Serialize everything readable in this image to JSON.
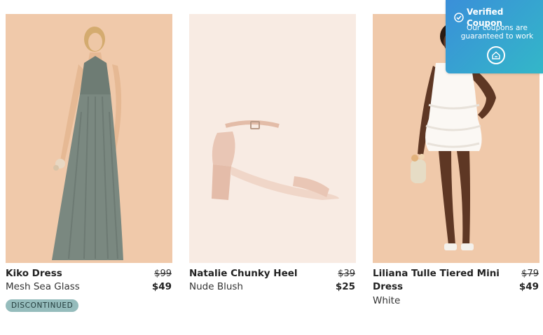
{
  "products": [
    {
      "name": "Kiko Dress",
      "variant": "Mesh Sea Glass",
      "old_price": "$99",
      "price": "$49",
      "badge": "DISCONTINUED",
      "image_bg": "#f0c9aa",
      "product_color": "#7a8880"
    },
    {
      "name": "Natalie Chunky Heel",
      "variant": "Nude Blush",
      "old_price": "$39",
      "price": "$25",
      "image_bg": "#f8ebe3",
      "product_color": "#e9c6b5"
    },
    {
      "name": "Liliana Tulle Tiered Mini Dress",
      "variant": "White",
      "old_price": "$79",
      "price": "$49",
      "image_bg": "#f0c9aa",
      "product_color": "#fbf8f4"
    }
  ],
  "coupon": {
    "title": "Verified Coupon",
    "description": "Our coupons are guaranteed to work",
    "logo_icon": "house-icon",
    "check_icon": "check-circle-icon"
  }
}
